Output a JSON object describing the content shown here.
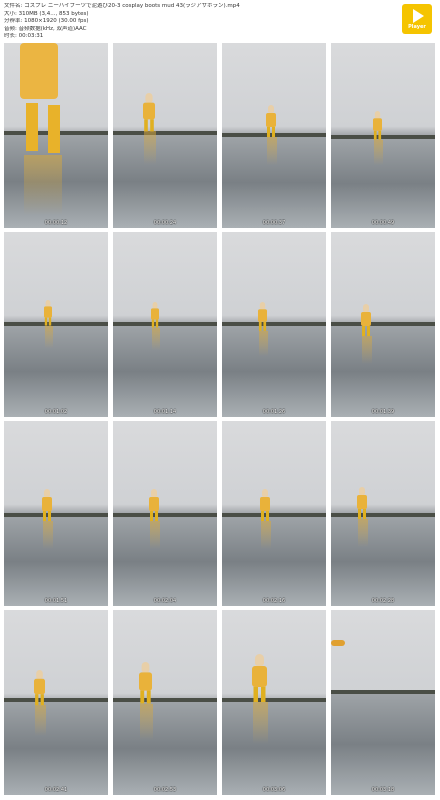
{
  "header": {
    "lines": [
      "文件名: コスプレ ニーハイブーツで泥遊び20-3 cosplay boots mud 43(ラジアサホラン).mp4",
      "大小: 310MB (3,4..., 853 bytes)",
      "分辨率: 1080×1920 (30.00 fps)",
      "音频: 音频数据(kHz, 双声道)AAC",
      "时长: 00:03:31"
    ]
  },
  "player_badge": {
    "label": "Player",
    "color": "#f5c400"
  },
  "thumbnails": [
    {
      "time": "00:00:12"
    },
    {
      "time": "00:00:24"
    },
    {
      "time": "00:00:37"
    },
    {
      "time": "00:00:49"
    },
    {
      "time": "00:01:02"
    },
    {
      "time": "00:01:14"
    },
    {
      "time": "00:01:26"
    },
    {
      "time": "00:01:39"
    },
    {
      "time": "00:01:51"
    },
    {
      "time": "00:02:04"
    },
    {
      "time": "00:02:16"
    },
    {
      "time": "00:02:28"
    },
    {
      "time": "00:02:41"
    },
    {
      "time": "00:02:53"
    },
    {
      "time": "00:03:06"
    },
    {
      "time": "00:03:18"
    }
  ]
}
